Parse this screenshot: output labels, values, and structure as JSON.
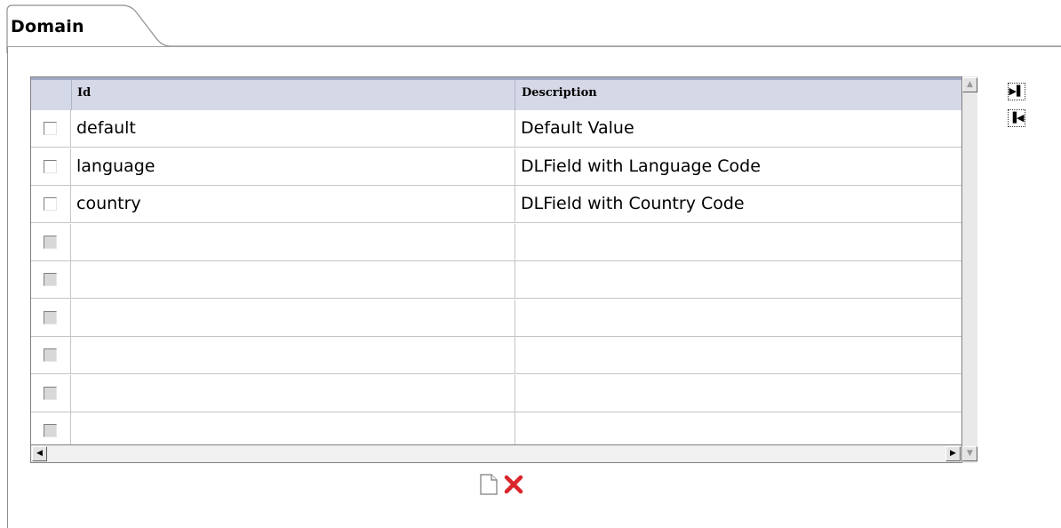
{
  "tab": {
    "label": "Domain"
  },
  "table": {
    "columns": {
      "id": "Id",
      "description": "Description"
    },
    "rows": [
      {
        "id": "default",
        "description": "Default Value",
        "enabled": true
      },
      {
        "id": "language",
        "description": "DLField with Language Code",
        "enabled": true
      },
      {
        "id": "country",
        "description": "DLField with Country Code",
        "enabled": true
      },
      {
        "id": "",
        "description": "",
        "enabled": false
      },
      {
        "id": "",
        "description": "",
        "enabled": false
      },
      {
        "id": "",
        "description": "",
        "enabled": false
      },
      {
        "id": "",
        "description": "",
        "enabled": false
      },
      {
        "id": "",
        "description": "",
        "enabled": false
      },
      {
        "id": "",
        "description": "",
        "enabled": false
      }
    ]
  },
  "icons": {
    "scroll_up": "scroll-up-arrow",
    "scroll_down": "scroll-down-arrow",
    "scroll_left": "scroll-left-arrow",
    "scroll_right": "scroll-right-arrow",
    "side_last": "last-page-icon",
    "side_first": "first-page-icon",
    "new": "new-document-icon",
    "delete": "delete-x-icon"
  },
  "colors": {
    "header_bg": "#d5d8e6",
    "header_border": "#a3a9c4",
    "delete_red": "#d9262b"
  }
}
